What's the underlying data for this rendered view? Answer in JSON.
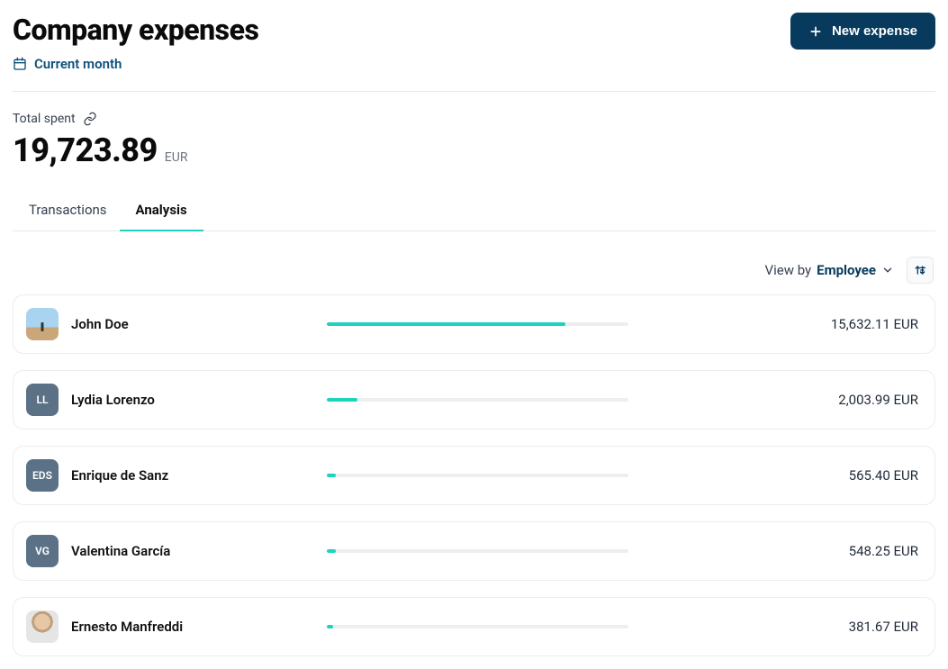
{
  "header": {
    "title": "Company expenses",
    "date_filter_label": "Current month",
    "new_expense_label": "New expense"
  },
  "total": {
    "label": "Total spent",
    "amount": "19,723.89",
    "currency": "EUR"
  },
  "tabs": [
    {
      "label": "Transactions",
      "active": false
    },
    {
      "label": "Analysis",
      "active": true
    }
  ],
  "viewby": {
    "prefix": "View by",
    "value": "Employee"
  },
  "employees": [
    {
      "name": "John Doe",
      "initials": "",
      "avatar_type": "photo1",
      "amount": "15,632.11 EUR",
      "bar_pct": 79
    },
    {
      "name": "Lydia Lorenzo",
      "initials": "LL",
      "avatar_type": "initials",
      "amount": "2,003.99 EUR",
      "bar_pct": 10
    },
    {
      "name": "Enrique de Sanz",
      "initials": "EDS",
      "avatar_type": "initials",
      "amount": "565.40 EUR",
      "bar_pct": 3
    },
    {
      "name": "Valentina García",
      "initials": "VG",
      "avatar_type": "initials",
      "amount": "548.25 EUR",
      "bar_pct": 3
    },
    {
      "name": "Ernesto Manfreddi",
      "initials": "",
      "avatar_type": "photo2",
      "amount": "381.67 EUR",
      "bar_pct": 2
    }
  ]
}
